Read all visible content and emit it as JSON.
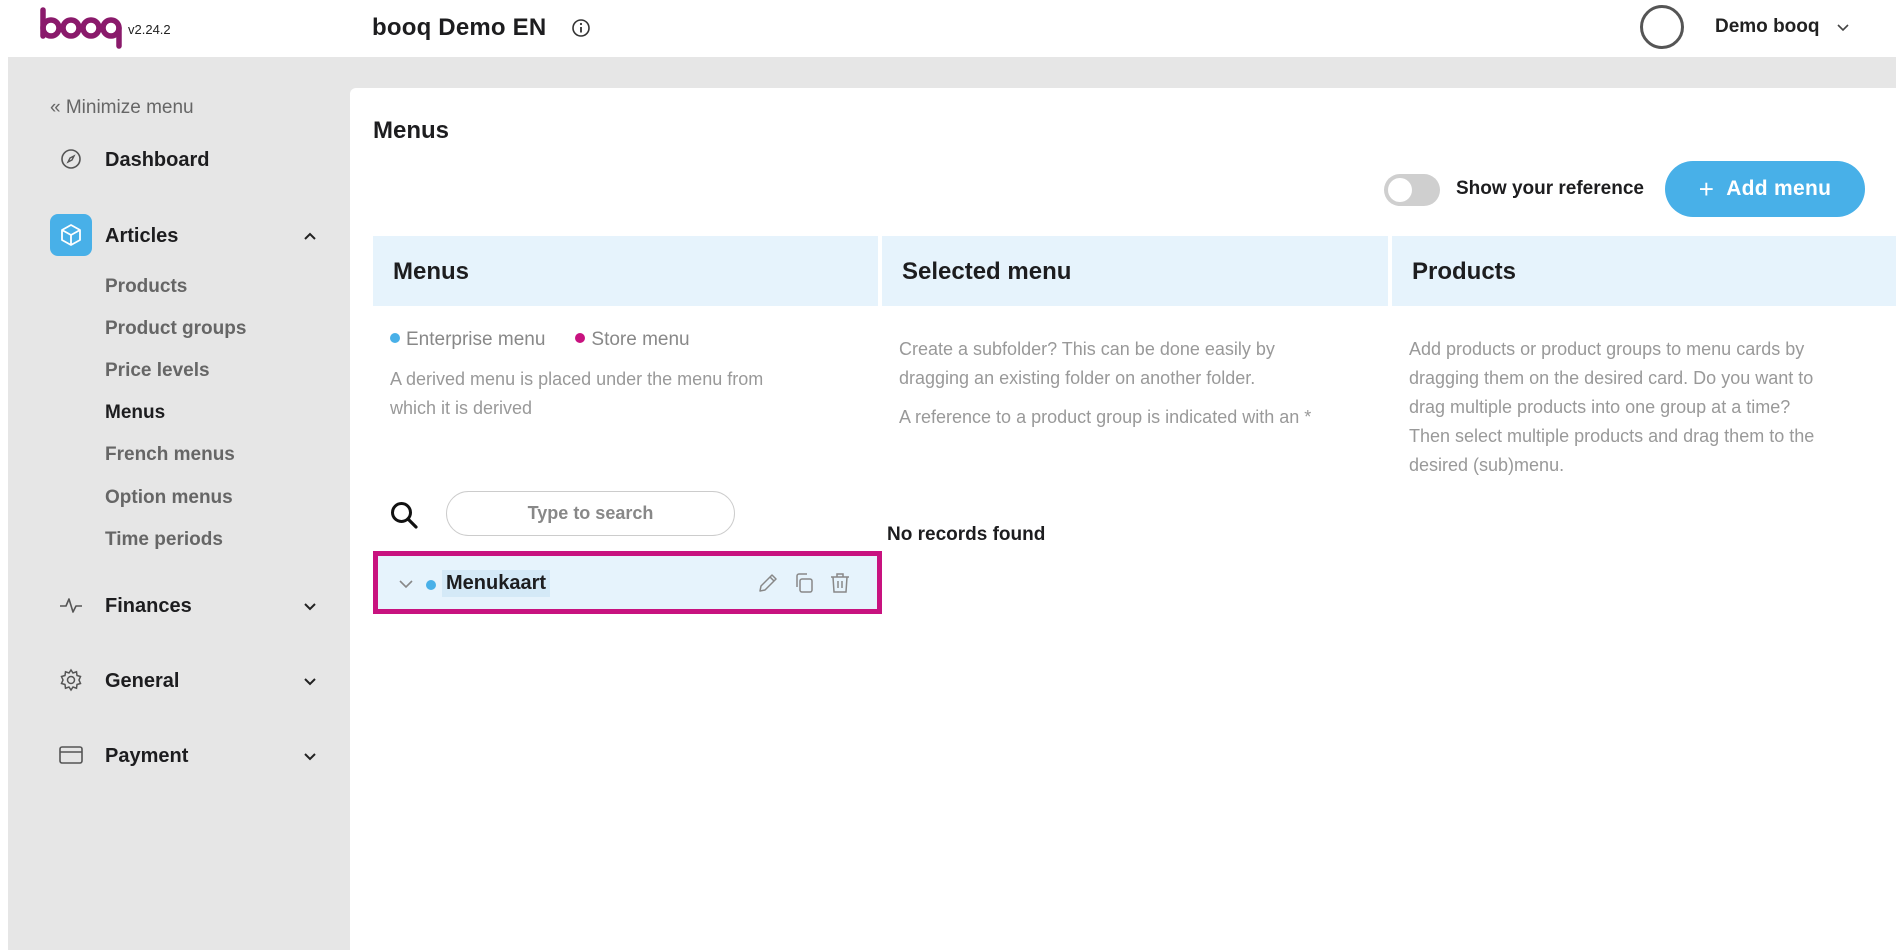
{
  "header": {
    "logo_text": "booq",
    "version": "v2.24.2",
    "environment_title": "booq Demo EN",
    "user_name": "Demo booq"
  },
  "sidebar": {
    "minimize_label": "« Minimize menu",
    "items": [
      {
        "label": "Dashboard",
        "icon": "compass-icon"
      },
      {
        "label": "Articles",
        "icon": "box-icon",
        "expanded": true,
        "active": true,
        "children": [
          "Products",
          "Product groups",
          "Price levels",
          "Menus",
          "French menus",
          "Option menus",
          "Time periods"
        ],
        "active_child": "Menus"
      },
      {
        "label": "Finances",
        "icon": "pulse-icon",
        "expanded": false
      },
      {
        "label": "General",
        "icon": "gear-icon",
        "expanded": false
      },
      {
        "label": "Payment",
        "icon": "card-icon",
        "expanded": false
      }
    ]
  },
  "main": {
    "page_title": "Menus",
    "toggle_label": "Show your reference",
    "toggle_on": false,
    "add_button_label": "Add menu",
    "columns": [
      {
        "title": "Menus"
      },
      {
        "title": "Selected menu"
      },
      {
        "title": "Products"
      }
    ],
    "legend": {
      "enterprise": "Enterprise menu",
      "store": "Store menu"
    },
    "menus_description": [
      "A derived menu is placed under the menu from",
      "which it is derived"
    ],
    "selected_description": [
      "Create a subfolder? This can be done easily by",
      "dragging an existing folder on another folder.",
      "A reference to a product group is indicated with an *"
    ],
    "products_description": [
      "Add products or product groups to menu cards by",
      "dragging them on the desired card. Do you want to",
      "drag multiple products into one group at a time?",
      "Then select multiple products and drag them to the",
      "desired (sub)menu."
    ],
    "search_placeholder": "Type to search",
    "no_records": "No records found",
    "menu_list": [
      {
        "label": "Menukaart",
        "type": "enterprise"
      }
    ]
  },
  "colors": {
    "accent": "#48b0e8",
    "store_menu": "#c8127f",
    "highlight_border": "#c8127f",
    "header_band": "#e6f3fc",
    "brand_logo": "#8a1a6b"
  }
}
